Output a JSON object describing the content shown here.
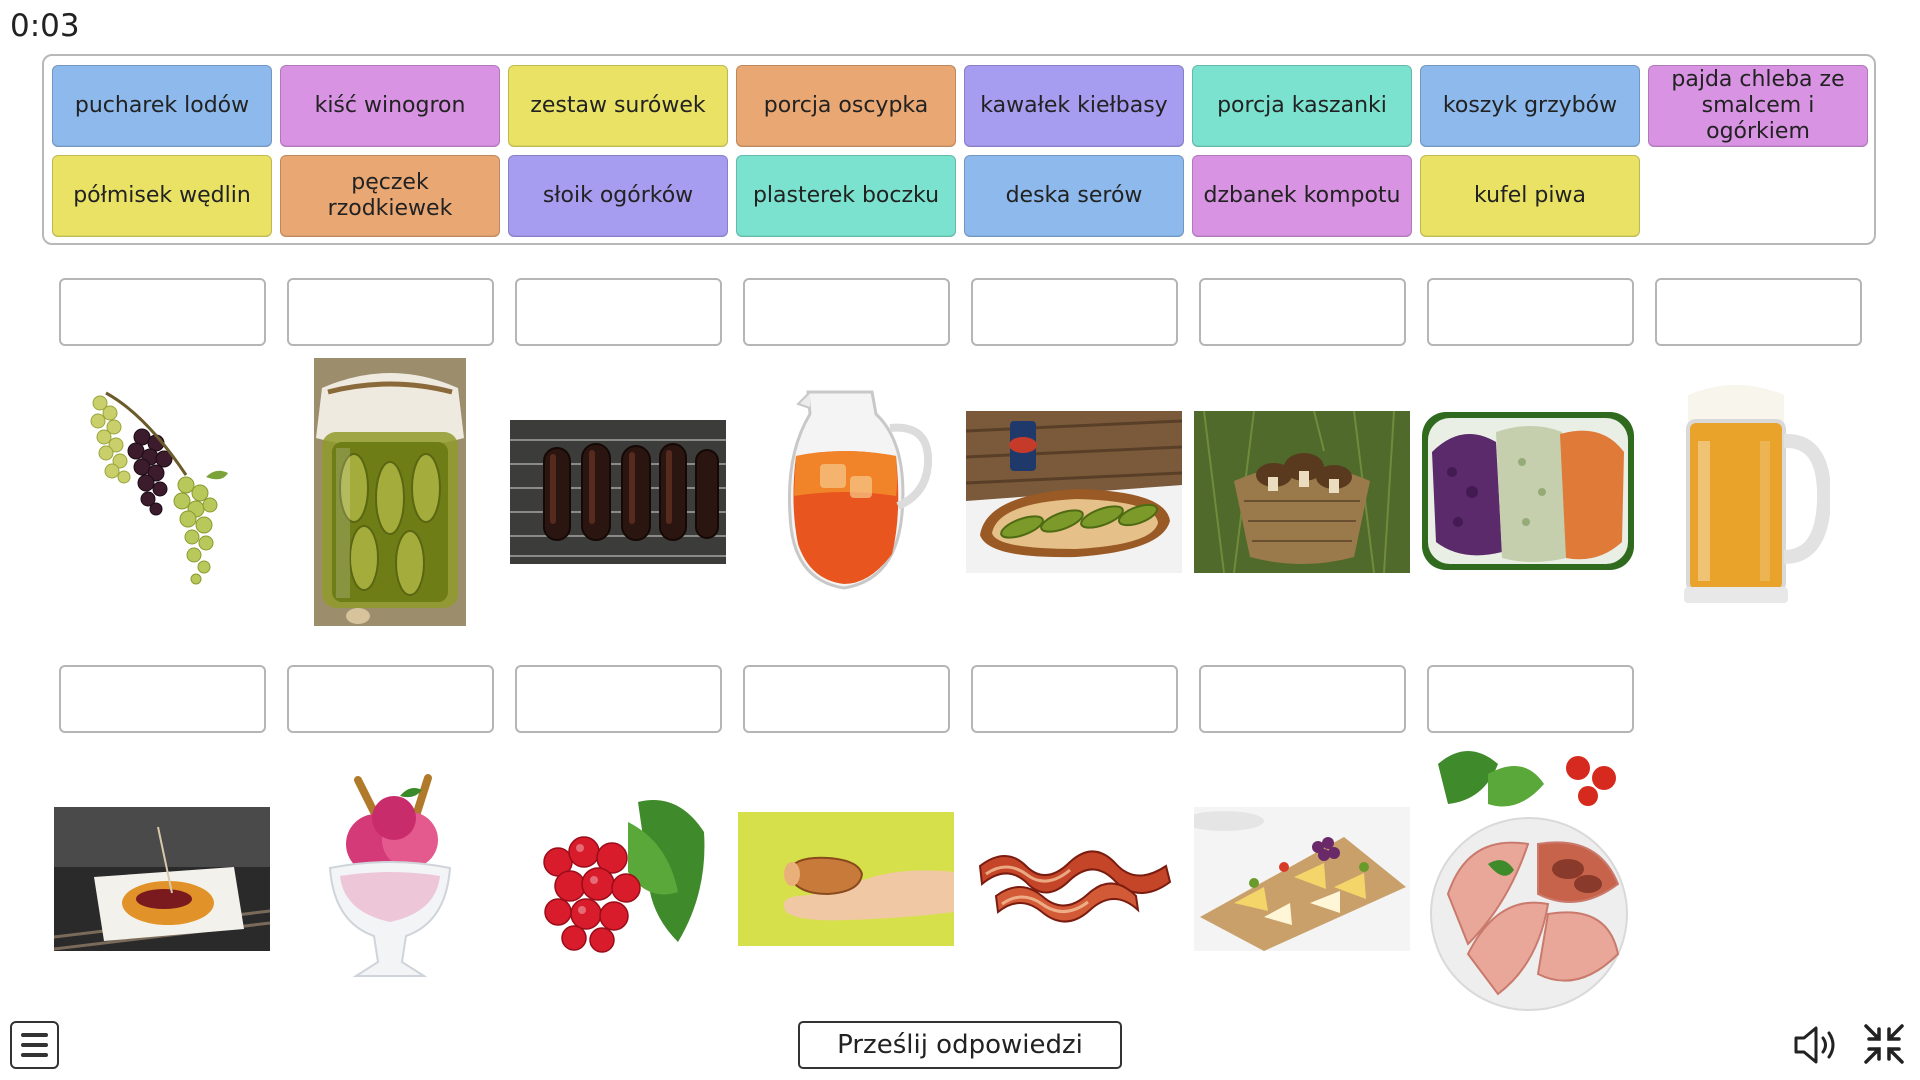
{
  "timer": "0:03",
  "tiles": [
    {
      "label": "pucharek lodów",
      "color": "#8db9ec"
    },
    {
      "label": "kiść winogron",
      "color": "#d893e3"
    },
    {
      "label": "zestaw surówek",
      "color": "#e9e265"
    },
    {
      "label": "porcja oscypka",
      "color": "#e8a773"
    },
    {
      "label": "kawałek kiełbasy",
      "color": "#a69cf0"
    },
    {
      "label": "porcja kaszanki",
      "color": "#7be2cf"
    },
    {
      "label": "koszyk grzybów",
      "color": "#8db9ec"
    },
    {
      "label": "pajda chleba ze smalcem i ogórkiem",
      "color": "#d893e3"
    },
    {
      "label": "półmisek wędlin",
      "color": "#e9e265"
    },
    {
      "label": "pęczek rzodkiewek",
      "color": "#e8a773"
    },
    {
      "label": "słoik ogórków",
      "color": "#a69cf0"
    },
    {
      "label": "plasterek boczku",
      "color": "#7be2cf"
    },
    {
      "label": "deska serów",
      "color": "#8db9ec"
    },
    {
      "label": "dzbanek kompotu",
      "color": "#d893e3"
    },
    {
      "label": "kufel piwa",
      "color": "#e9e265"
    }
  ],
  "drop_zones": {
    "row1": [
      "",
      "",
      "",
      "",
      "",
      "",
      "",
      ""
    ],
    "row2": [
      "",
      "",
      "",
      "",
      "",
      "",
      ""
    ]
  },
  "pictures": {
    "row1": [
      "grapes-image",
      "pickle-jar-image",
      "black-pudding-image",
      "compote-jug-image",
      "bread-lard-pickle-image",
      "mushroom-basket-image",
      "salads-image",
      "beer-mug-image"
    ],
    "row2": [
      "oscypek-image",
      "ice-cream-cup-image",
      "radish-bunch-image",
      "sausage-piece-image",
      "bacon-slices-image",
      "cheese-board-image",
      "cold-cuts-platter-image"
    ]
  },
  "controls": {
    "menu_icon": "hamburger-menu-icon",
    "submit_label": "Prześlij odpowiedzi",
    "sound_icon": "speaker-icon",
    "collapse_icon": "exit-fullscreen-icon"
  }
}
